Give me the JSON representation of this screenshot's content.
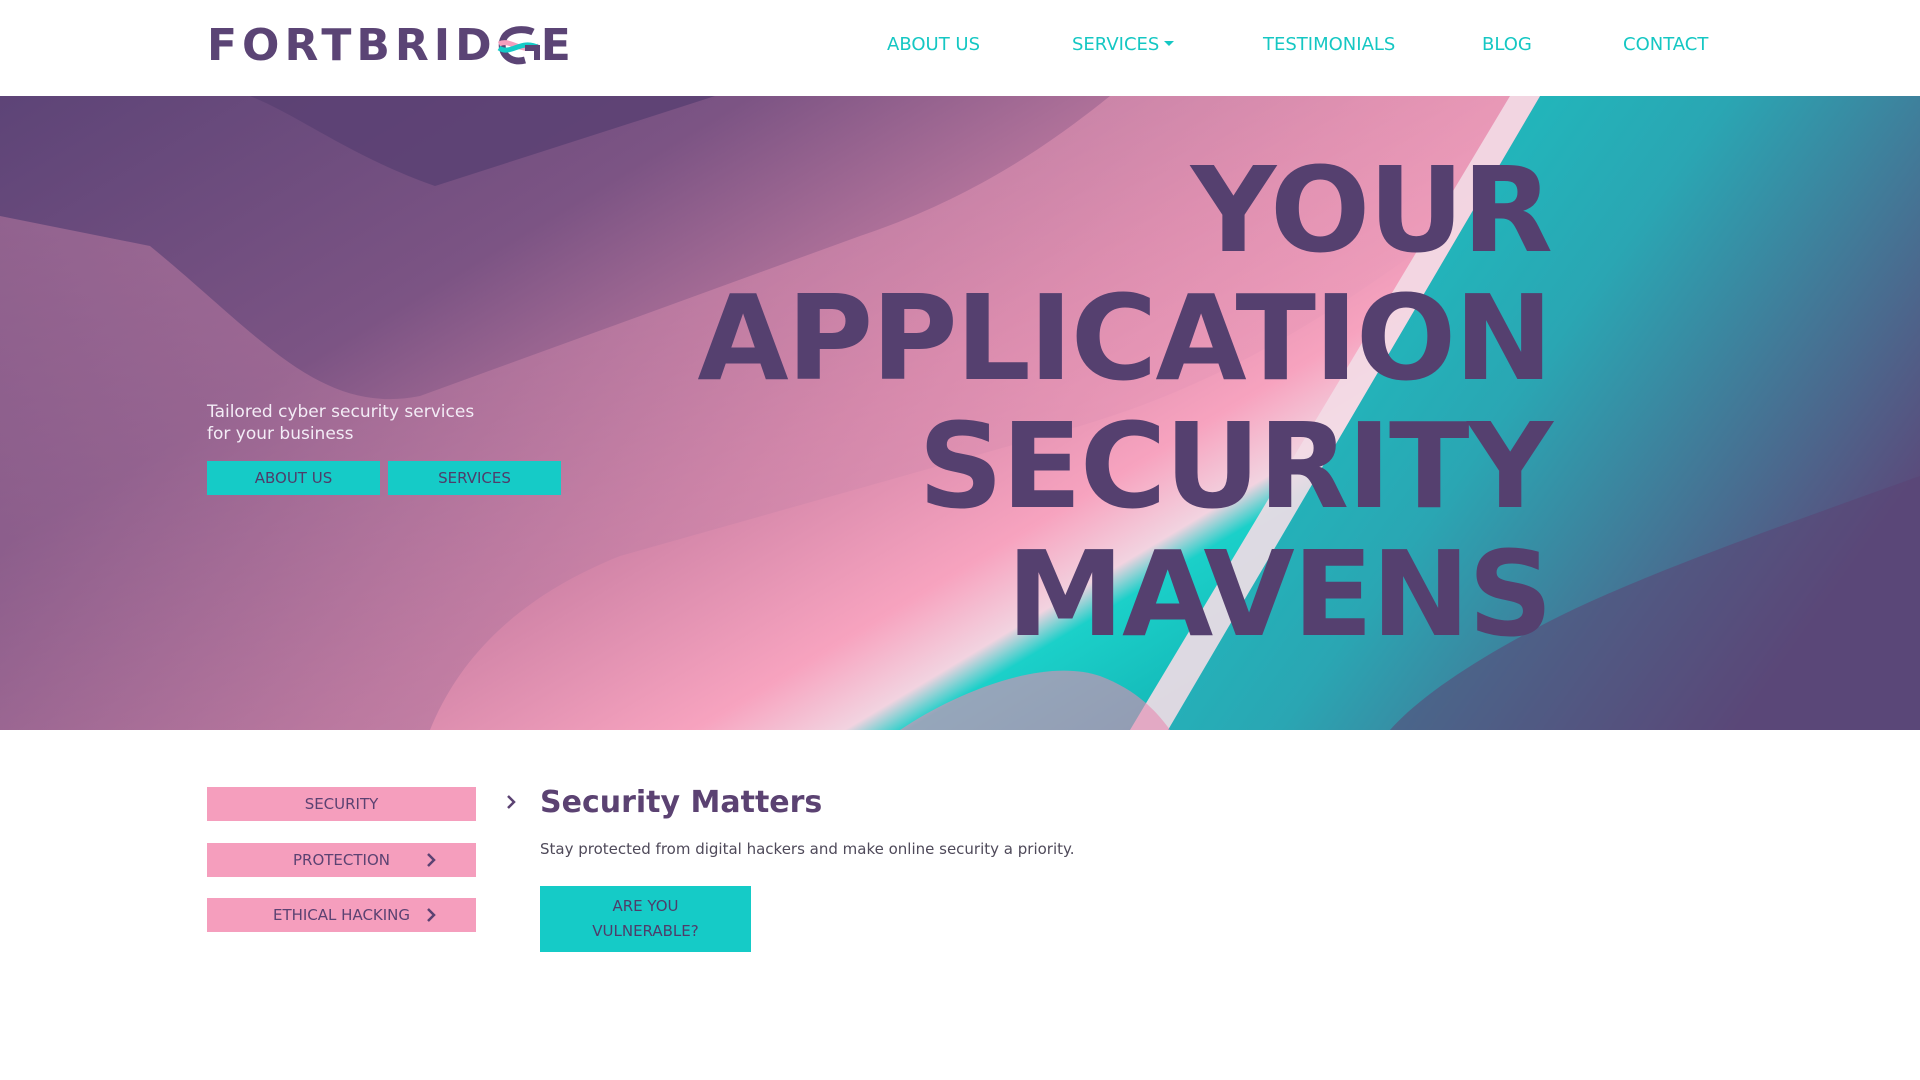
{
  "logo": {
    "text_before": "FORTBRID",
    "text_after": "E"
  },
  "nav": {
    "about": "ABOUT US",
    "services": "SERVICES",
    "testimonials": "TESTIMONIALS",
    "blog": "BLOG",
    "contact": "CONTACT"
  },
  "hero": {
    "tagline_line1": "Tailored cyber security services",
    "tagline_line2": "for your business",
    "about_button": "ABOUT US",
    "services_button": "SERVICES",
    "headline": [
      "YOUR",
      "APPLICATION",
      "SECURITY",
      "MAVENS"
    ]
  },
  "sidebar": {
    "items": [
      {
        "label": "SECURITY"
      },
      {
        "label": "PROTECTION"
      },
      {
        "label": "ETHICAL HACKING"
      }
    ]
  },
  "main": {
    "title": "Security Matters",
    "text": "Stay protected from digital hackers and make online security a priority.",
    "cta_line1": "ARE YOU",
    "cta_line2": "VULNERABLE?"
  },
  "colors": {
    "brand_purple": "#5b4475",
    "accent_teal": "#15cbc7",
    "accent_pink": "#f59ebd"
  },
  "icons": {
    "nav_dropdown": "caret-down-icon",
    "menu_chevron": "chevron-right-icon"
  }
}
